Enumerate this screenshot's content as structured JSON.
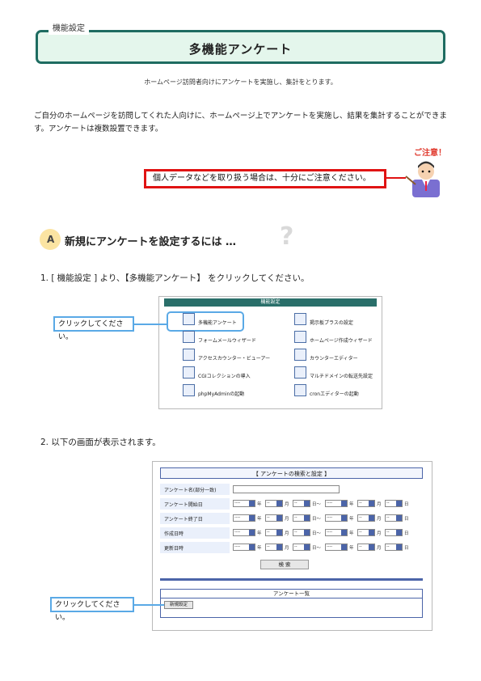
{
  "header": {
    "tab": "機能設定",
    "title": "多機能アンケート"
  },
  "subtitle": "ホームページ訪問者向けにアンケートを実施し、集計をとります。",
  "intro": "ご自分のホームページを訪問してくれた人向けに、ホームページ上でアンケートを実施し、結果を集計することができます。アンケートは複数設置できます。",
  "warning": {
    "label": "ご注意！",
    "text": "個人データなどを取り扱う場合は、十分にご注意ください。"
  },
  "section_a": {
    "letter": "A",
    "title": "新規にアンケートを設定するには …"
  },
  "step1": "1. [ 機能設定 ] より、【多機能アンケート】 をクリックしてください。",
  "step2": "2. 以下の画面が表示されます。",
  "callout": "クリックしてください。",
  "menu": {
    "header": "機能設定",
    "left": [
      "多機能アンケート",
      "フォームメールウィザード",
      "アクセスカウンター・ビューアー",
      "CGIコレクションの導入",
      "phpMyAdminの起動"
    ],
    "right": [
      "掲示板プラスの設定",
      "ホームページ作成ウィザード",
      "カウンターエディター",
      "マルチドメインの転送先設定",
      "cronエディターの起動"
    ],
    "icons_left": [
      "survey-icon",
      "form-mail-icon",
      "access-counter-icon",
      "cgi-collection-icon",
      "phpmyadmin-icon"
    ],
    "icons_right": [
      "bbs-icon",
      "homepage-wizard-icon",
      "counter-editor-icon",
      "multidomain-icon",
      "cron-editor-icon"
    ]
  },
  "search": {
    "title": "【 アンケートの検索と設定 】",
    "rows": [
      "アンケート名(部分一致)",
      "アンケート開始日",
      "アンケート終了日",
      "作成日時",
      "更新日時"
    ],
    "select_placeholder_year": "----",
    "select_placeholder": "--",
    "units": [
      "年",
      "月",
      "日〜",
      "年",
      "月",
      "日"
    ],
    "search_button": "検 索",
    "list_title": "アンケート一覧",
    "new_button": "新規設定"
  }
}
